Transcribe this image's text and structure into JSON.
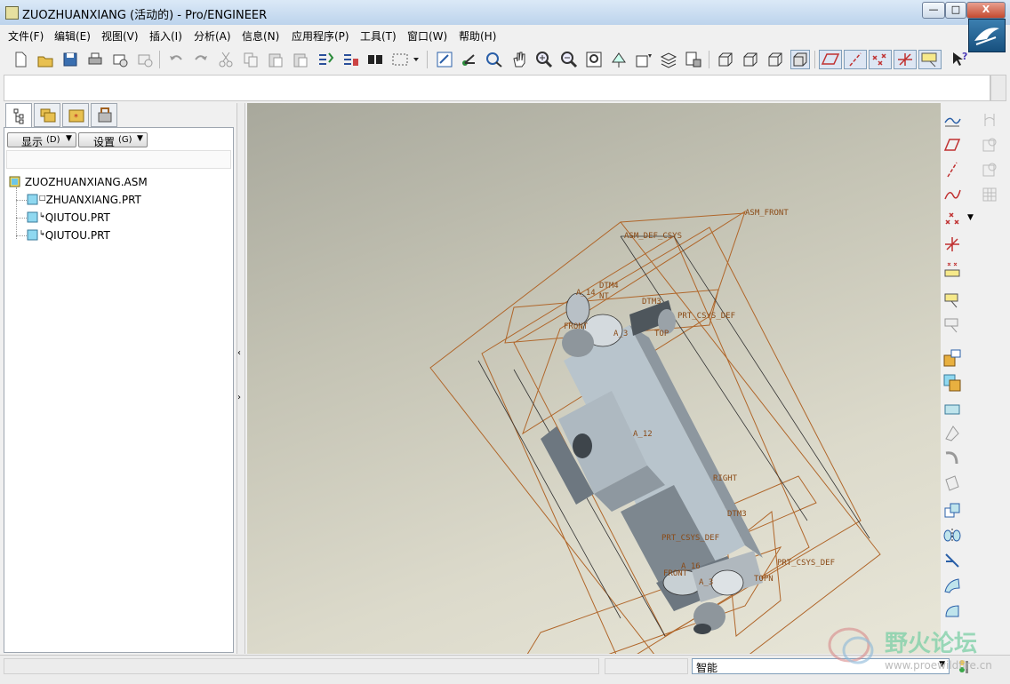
{
  "window": {
    "title": "ZUOZHUANXIANG (活动的) - Pro/ENGINEER",
    "minimize": "—",
    "maximize": "□",
    "close": "X"
  },
  "menu": [
    "文件(F)",
    "编辑(E)",
    "视图(V)",
    "插入(I)",
    "分析(A)",
    "信息(N)",
    "应用程序(P)",
    "工具(T)",
    "窗口(W)",
    "帮助(H)"
  ],
  "panel": {
    "show_button": "显示",
    "show_key": "(D)",
    "settings_button": "设置",
    "settings_key": "(G)"
  },
  "tree": {
    "root": "ZUOZHUANXIANG.ASM",
    "children": [
      "ZHUANXIANG.PRT",
      "QIUTOU.PRT",
      "QIUTOU.PRT"
    ]
  },
  "viewport": {
    "labels": {
      "asm_front": "ASM_FRONT",
      "asm_def_csys": "ASM_DEF_CSYS",
      "dtm4": "DTM4",
      "a_14": "A_14",
      "nt": "NT",
      "dtm3_top": "DTM3",
      "prt_csys_top": "PRT_CSYS_DEF",
      "front_top": "FRONT",
      "a_3_top": "A_3",
      "top_top": "TOP",
      "a_12": "A_12",
      "right": "RIGHT",
      "dtm3_bottom": "DTM3",
      "prt_csys_mid": "PRT_CSYS_DEF",
      "a_16": "A_16",
      "prt_csys_bottom": "PRT_CSYS_DEF",
      "front_bottom": "FRONT",
      "a_3_bottom": "A_3",
      "top_bottom": "TOPN"
    }
  },
  "status": {
    "filter": "智能"
  },
  "watermark": {
    "text": "野火论坛",
    "url": "www.proewildfire.cn"
  },
  "colors": {
    "datum": "#b0662a",
    "part_light": "#b8c4cc",
    "part_dark": "#6d7780"
  }
}
